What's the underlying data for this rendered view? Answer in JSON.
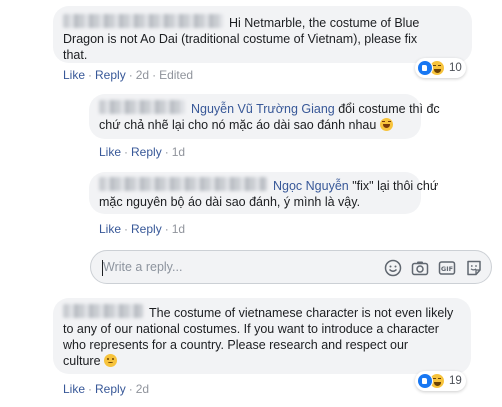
{
  "comments": [
    {
      "text": "Hi Netmarble, the costume of Blue Dragon is not Ao Dai (traditional costume of Vietnam), please fix that.",
      "line1": "Hi Netmarble, the costume of Blue",
      "line2": "Dragon is not Ao Dai (traditional costume of Vietnam), please fix",
      "line3": "that.",
      "actions": {
        "like": "Like",
        "reply": "Reply",
        "time": "2d",
        "edited": "Edited"
      },
      "reaction_count": "10",
      "reaction_icons": [
        "like-reaction-icon",
        "haha-reaction-icon"
      ]
    },
    {
      "author": "Nguyễn Vũ Trường Giang",
      "line1_rest": " đổi costume thì đc",
      "line2": "chứ chả nhẽ lại cho nó mặc áo dài sao đánh nhau",
      "emoji": "laughing-emoji",
      "actions": {
        "like": "Like",
        "reply": "Reply",
        "time": "1d"
      }
    },
    {
      "author": "Ngọc Nguyễn",
      "line1_rest": " \"fix\" lại thôi chứ",
      "line2": "mặc nguyên bộ áo dài sao đánh, ý mình là vậy.",
      "actions": {
        "like": "Like",
        "reply": "Reply",
        "time": "1d"
      }
    },
    {
      "line1": "The costume of vietnamese character is not even likely",
      "line2": "to any of our national costumes. If you want to introduce a character",
      "line3": "who represents for a country. Please research and respect our",
      "line4": "culture",
      "emoji": "sad-emoji",
      "actions": {
        "like": "Like",
        "reply": "Reply",
        "time": "2d"
      },
      "reaction_count": "19",
      "reaction_icons": [
        "like-reaction-icon",
        "haha-reaction-icon"
      ]
    }
  ],
  "reply_box": {
    "placeholder": "Write a reply...",
    "tools": [
      "emoji-icon",
      "camera-icon",
      "gif-icon",
      "sticker-icon"
    ]
  },
  "colors": {
    "link": "#385898",
    "bubble": "#f2f3f5",
    "like_blue": "#1877f2",
    "haha_yellow": "#f7c33c"
  }
}
